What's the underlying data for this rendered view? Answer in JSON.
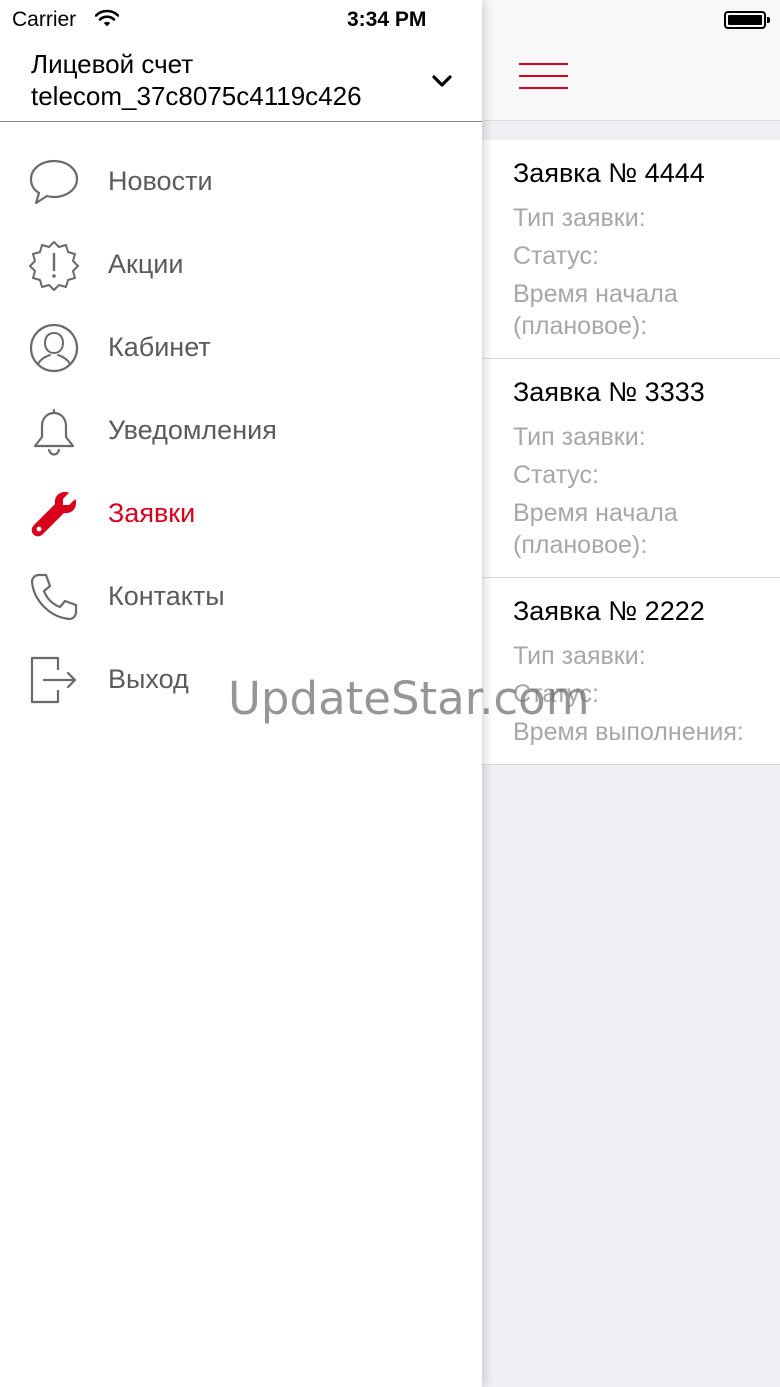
{
  "status_bar": {
    "carrier": "Carrier",
    "time": "3:34 PM"
  },
  "account": {
    "label": "Лицевой счет",
    "id": "telecom_37c8075c4119c426"
  },
  "menu": {
    "items": [
      {
        "label": "Новости",
        "icon": "speech-bubble-icon"
      },
      {
        "label": "Акции",
        "icon": "alert-badge-icon"
      },
      {
        "label": "Кабинет",
        "icon": "user-icon"
      },
      {
        "label": "Уведомления",
        "icon": "bell-icon"
      },
      {
        "label": "Заявки",
        "icon": "wrench-icon",
        "active": true
      },
      {
        "label": "Контакты",
        "icon": "phone-icon"
      },
      {
        "label": "Выход",
        "icon": "logout-icon"
      }
    ]
  },
  "requests": [
    {
      "title": "Заявка № 4444",
      "type_label": "Тип заявки:",
      "status_label": "Статус:",
      "time_label_1": "Время начала",
      "time_label_2": "(плановое):"
    },
    {
      "title": "Заявка № 3333",
      "type_label": "Тип заявки:",
      "status_label": "Статус:",
      "time_label_1": "Время начала",
      "time_label_2": "(плановое):"
    },
    {
      "title": "Заявка № 2222",
      "type_label": "Тип заявки:",
      "status_label": "Статус:",
      "time_label_1": "Время выполнения:"
    }
  ],
  "watermark": "UpdateStar.com",
  "colors": {
    "accent": "#d9001b",
    "menu_text": "#5b5b5b",
    "secondary_text": "#a7a7a7",
    "panel_background": "#efeff4"
  }
}
